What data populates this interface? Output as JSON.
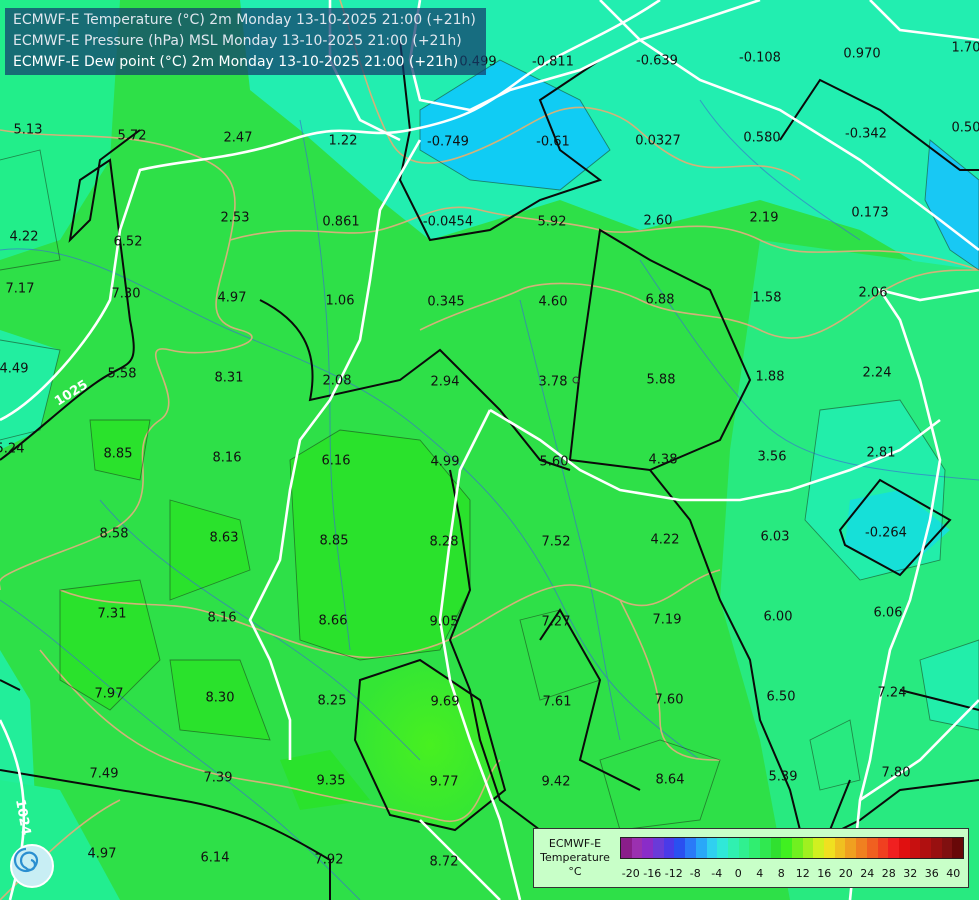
{
  "header": {
    "lines": [
      "ECMWF-E Temperature (°C) 2m Monday 13-10-2025 21:00 (+21h)",
      "ECMWF-E Pressure (hPa) MSL Monday 13-10-2025 21:00 (+21h)",
      "ECMWF-E Dew point (°C) 2m Monday 13-10-2025 21:00 (+21h)"
    ]
  },
  "values": [
    "0.499",
    "-0.811",
    "-0.639",
    "-0.108",
    "0.970",
    "1.70",
    "5.13",
    "5.72",
    "2.47",
    "1.22",
    "-0.749",
    "-0.61",
    "0.0327",
    "0.580",
    "-0.342",
    "0.50",
    "4.22",
    "6.52",
    "2.53",
    "0.861",
    "-0.0454",
    "5.92",
    "2.60",
    "2.19",
    "0.173",
    "7.17",
    "7.30",
    "4.97",
    "1.06",
    "0.345",
    "4.60",
    "6.88",
    "1.58",
    "2.06",
    "4.49",
    "5.58",
    "8.31",
    "2.08",
    "2.94",
    "3.78",
    "5.88",
    "1.88",
    "2.24",
    "5.24",
    "8.85",
    "8.16",
    "6.16",
    "4.99",
    "5.60",
    "4.38",
    "3.56",
    "2.81",
    "8.58",
    "8.63",
    "8.85",
    "8.28",
    "7.52",
    "4.22",
    "6.03",
    "-0.264",
    "7.31",
    "8.16",
    "8.66",
    "9.05",
    "7.27",
    "7.19",
    "6.00",
    "6.06",
    "7.97",
    "8.30",
    "8.25",
    "9.69",
    "7.61",
    "7.60",
    "6.50",
    "7.24",
    "7.49",
    "7.39",
    "9.35",
    "9.77",
    "9.42",
    "8.64",
    "5.39",
    "7.80",
    "4.97",
    "6.14",
    "7.92",
    "8.72"
  ],
  "isobar_labels": [
    "1025",
    "1024"
  ],
  "legend": {
    "title": "ECMWF-E",
    "subtitle": "Temperature",
    "unit": "°C",
    "ticks": [
      "-20",
      "-16",
      "-12",
      "-8",
      "-4",
      "0",
      "4",
      "8",
      "12",
      "16",
      "20",
      "24",
      "28",
      "32",
      "36",
      "40"
    ],
    "colors": [
      "#8a1e8a",
      "#9b30b0",
      "#8a2cc8",
      "#6a3ad8",
      "#4a3ae8",
      "#2a50f0",
      "#2a7af8",
      "#2aa8f8",
      "#30d0f0",
      "#30e8d8",
      "#30f0b0",
      "#30f090",
      "#30ee70",
      "#30e850",
      "#30e030",
      "#40f020",
      "#70f020",
      "#a0f020",
      "#d0f020",
      "#f0e020",
      "#f0c020",
      "#f0a020",
      "#f08020",
      "#f06020",
      "#f04020",
      "#f02020",
      "#e01010",
      "#c81010",
      "#b01010",
      "#981010",
      "#801010",
      "#680808"
    ]
  }
}
